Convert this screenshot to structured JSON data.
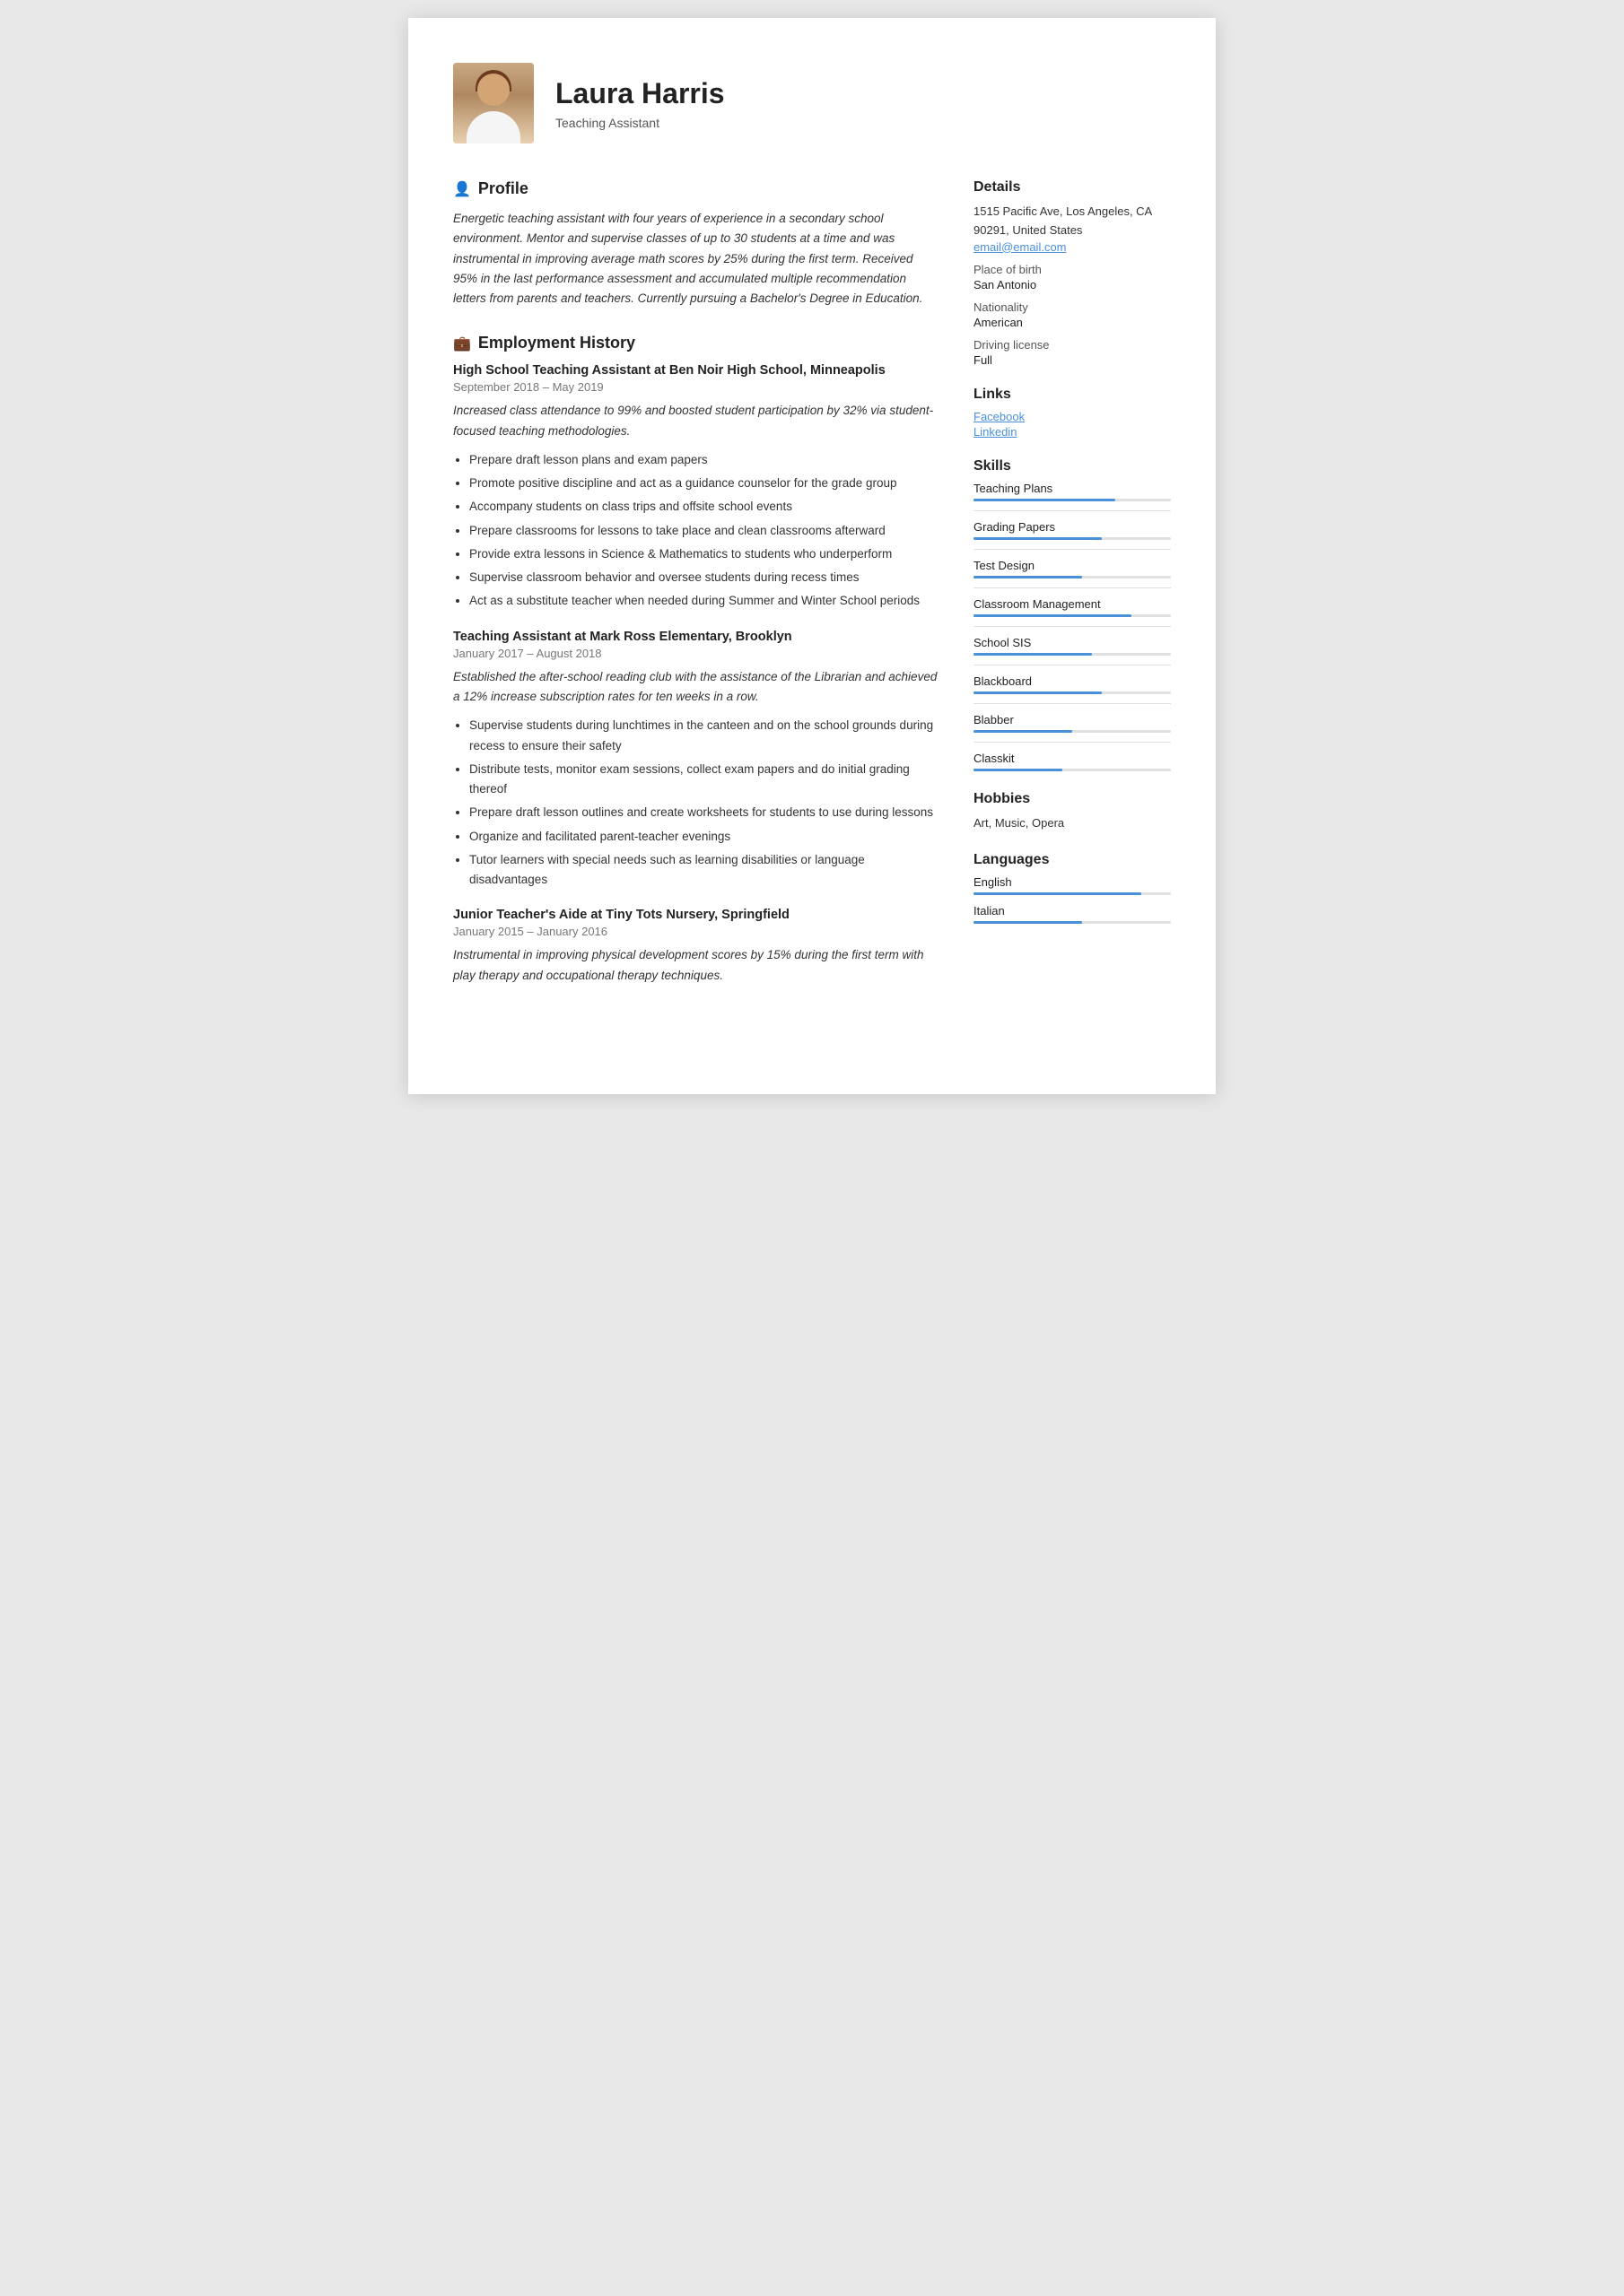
{
  "header": {
    "name": "Laura Harris",
    "title": "Teaching Assistant"
  },
  "profile": {
    "section_title": "Profile",
    "text": "Energetic teaching assistant with four years of experience in a secondary school environment. Mentor and supervise classes of up to 30 students at a time and was instrumental in improving average math scores by 25% during the first term. Received 95% in the last performance assessment and accumulated multiple recommendation letters from parents and teachers. Currently pursuing a Bachelor's Degree in Education."
  },
  "employment": {
    "section_title": "Employment History",
    "jobs": [
      {
        "title": "High School Teaching Assistant at Ben Noir High School, Minneapolis",
        "dates": "September 2018  –  May 2019",
        "description": "Increased class attendance to 99% and boosted student participation by 32% via student-focused teaching methodologies.",
        "bullets": [
          "Prepare draft lesson plans and exam papers",
          "Promote positive discipline and act as a guidance counselor for the grade group",
          "Accompany students on class trips and offsite school events",
          "Prepare classrooms for lessons to take place and clean classrooms afterward",
          "Provide extra lessons in Science & Mathematics to students who underperform",
          "Supervise classroom behavior and oversee students during recess times",
          "Act as a substitute teacher when needed during Summer and Winter School periods"
        ]
      },
      {
        "title": "Teaching Assistant at Mark Ross Elementary, Brooklyn",
        "dates": "January 2017  –  August 2018",
        "description": "Established the after-school reading club with the assistance of the Librarian and achieved a 12% increase subscription rates for ten weeks in a row.",
        "bullets": [
          "Supervise students during lunchtimes in the canteen and on the school grounds during recess to ensure their safety",
          "Distribute tests, monitor exam sessions, collect exam papers and do initial grading thereof",
          "Prepare draft lesson outlines and create worksheets for students to use during lessons",
          "Organize and facilitated parent-teacher evenings",
          "Tutor learners with special needs such as learning disabilities or language disadvantages"
        ]
      },
      {
        "title": "Junior Teacher's Aide at Tiny Tots Nursery, Springfield",
        "dates": "January 2015  –  January 2016",
        "description": "Instrumental in improving physical development scores by 15% during the first term with play therapy and occupational therapy techniques.",
        "bullets": []
      }
    ]
  },
  "details": {
    "section_title": "Details",
    "address": "1515 Pacific Ave, Los Angeles, CA 90291, United States",
    "email": "email@email.com",
    "place_of_birth_label": "Place of birth",
    "place_of_birth": "San Antonio",
    "nationality_label": "Nationality",
    "nationality": "American",
    "driving_license_label": "Driving license",
    "driving_license": "Full"
  },
  "links": {
    "section_title": "Links",
    "items": [
      {
        "label": "Facebook",
        "url": "#"
      },
      {
        "label": "Linkedin",
        "url": "#"
      }
    ]
  },
  "skills": {
    "section_title": "Skills",
    "items": [
      {
        "name": "Teaching Plans",
        "pct": 72
      },
      {
        "name": "Grading Papers",
        "pct": 65
      },
      {
        "name": "Test Design",
        "pct": 55
      },
      {
        "name": "Classroom Management",
        "pct": 80
      },
      {
        "name": "School SIS",
        "pct": 60
      },
      {
        "name": "Blackboard",
        "pct": 65
      },
      {
        "name": "Blabber",
        "pct": 50
      },
      {
        "name": "Classkit",
        "pct": 45
      }
    ]
  },
  "hobbies": {
    "section_title": "Hobbies",
    "text": "Art, Music, Opera"
  },
  "languages": {
    "section_title": "Languages",
    "items": [
      {
        "name": "English",
        "pct": 85
      },
      {
        "name": "Italian",
        "pct": 55
      }
    ]
  }
}
